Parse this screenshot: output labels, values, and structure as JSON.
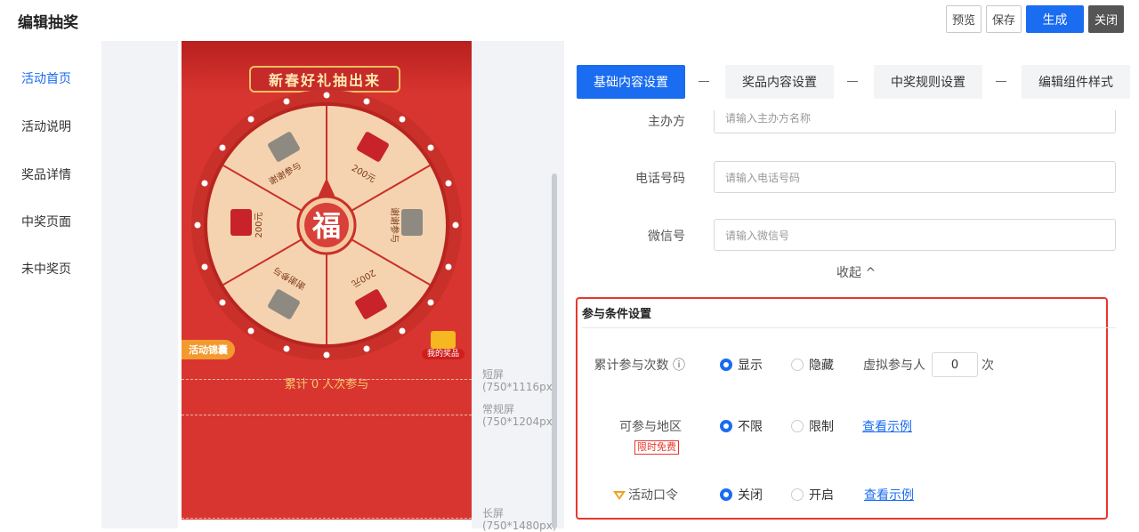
{
  "header": {
    "title": "编辑抽奖",
    "preview": "预览",
    "save": "保存",
    "generate": "生成",
    "close": "关闭"
  },
  "sidebar": {
    "items": [
      {
        "label": "活动首页",
        "active": true
      },
      {
        "label": "活动说明"
      },
      {
        "label": "奖品详情"
      },
      {
        "label": "中奖页面"
      },
      {
        "label": "未中奖页"
      }
    ]
  },
  "preview": {
    "banner": "新春好礼抽出来",
    "center": "福",
    "prizes": [
      "谢谢参与",
      "200元",
      "谢谢参与",
      "200元",
      "谢谢参与",
      "200元"
    ],
    "left_tag": "活动锦囊",
    "right_tag": "我的奖品",
    "count_text": "累计 0 人次参与",
    "sizes": [
      {
        "name": "短屏",
        "dim": "(750*1116px)"
      },
      {
        "name": "常规屏",
        "dim": "(750*1204px)"
      },
      {
        "name": "长屏",
        "dim": "(750*1480px)"
      }
    ]
  },
  "steps": [
    "基础内容设置",
    "奖品内容设置",
    "中奖规则设置",
    "编辑组件样式"
  ],
  "form": {
    "organizer_label": "主办方",
    "organizer_placeholder": "请输入主办方名称",
    "phone_label": "电话号码",
    "phone_placeholder": "请输入电话号码",
    "wechat_label": "微信号",
    "wechat_placeholder": "请输入微信号",
    "collapse": "收起 ^"
  },
  "conditions": {
    "title": "参与条件设置",
    "cumulative_label": "累计参与次数 ⓘ",
    "show": "显示",
    "hide": "隐藏",
    "virtual_label": "虚拟参与人",
    "virtual_value": "0",
    "times_unit": "次",
    "region_label": "可参与地区",
    "region_badge": "限时免费",
    "unlimited": "不限",
    "limited": "限制",
    "example1": "查看示例",
    "password_label": "活动口令",
    "off": "关闭",
    "on": "开启",
    "example2": "查看示例"
  },
  "colors": {
    "primary": "#1a6cf0",
    "highlight": "#e8372e",
    "preview_red": "#d93530"
  }
}
